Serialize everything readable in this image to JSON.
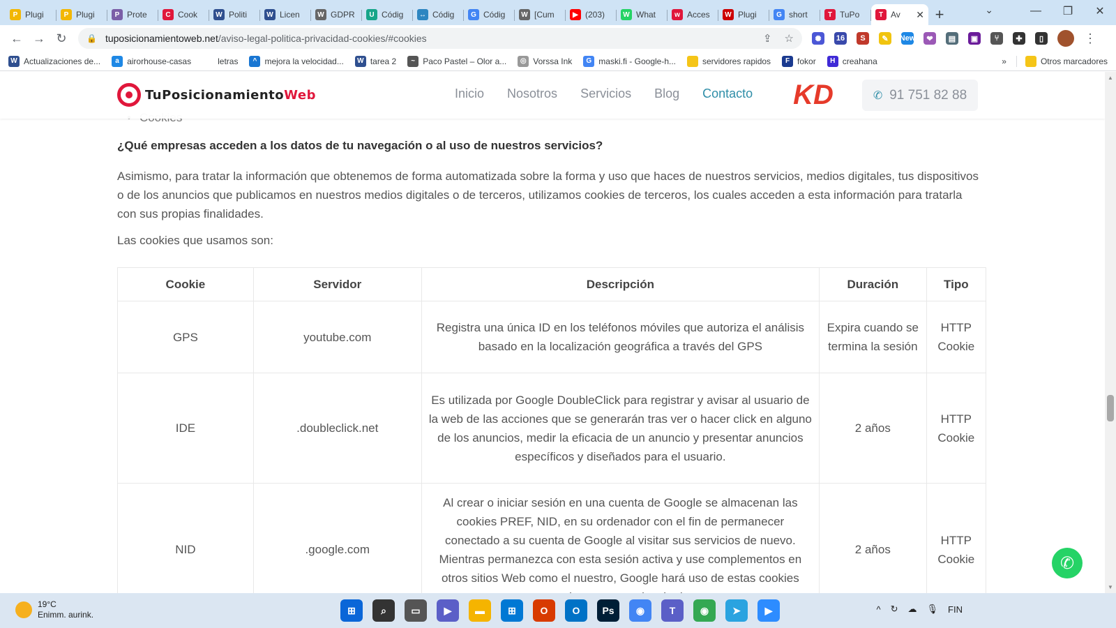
{
  "browser": {
    "tabs": [
      {
        "title": "Plugi",
        "icon_color": "#f2b705",
        "icon_glyph": "P"
      },
      {
        "title": "Plugi",
        "icon_color": "#f2b705",
        "icon_glyph": "P"
      },
      {
        "title": "Prote",
        "icon_color": "#7b5ea7",
        "icon_glyph": "P"
      },
      {
        "title": "Cook",
        "icon_color": "#e0173b",
        "icon_glyph": "C"
      },
      {
        "title": "Politi",
        "icon_color": "#2f4f8f",
        "icon_glyph": "W"
      },
      {
        "title": "Licen",
        "icon_color": "#2f4f8f",
        "icon_glyph": "W"
      },
      {
        "title": "GDPR",
        "icon_color": "#666666",
        "icon_glyph": "W"
      },
      {
        "title": "Códig",
        "icon_color": "#17a589",
        "icon_glyph": "U"
      },
      {
        "title": "Códig",
        "icon_color": "#2e86c1",
        "icon_glyph": "↔"
      },
      {
        "title": "Códig",
        "icon_color": "#4285f4",
        "icon_glyph": "G"
      },
      {
        "title": "[Cum",
        "icon_color": "#666666",
        "icon_glyph": "W"
      },
      {
        "title": "(203)",
        "icon_color": "#ff0000",
        "icon_glyph": "▶"
      },
      {
        "title": "What",
        "icon_color": "#25d366",
        "icon_glyph": "W"
      },
      {
        "title": "Acces",
        "icon_color": "#e0173b",
        "icon_glyph": "w"
      },
      {
        "title": "Plugi",
        "icon_color": "#cc0000",
        "icon_glyph": "W"
      },
      {
        "title": "short",
        "icon_color": "#4285f4",
        "icon_glyph": "G"
      },
      {
        "title": "TuPo",
        "icon_color": "#e0173b",
        "icon_glyph": "T"
      },
      {
        "title": "Av",
        "icon_color": "#e0173b",
        "icon_glyph": "T"
      }
    ],
    "close_glyph": "✕",
    "new_tab_glyph": "+",
    "tab_search_glyph": "⌄",
    "window_controls": [
      "—",
      "❐",
      "✕"
    ],
    "nav": {
      "back": "←",
      "forward": "→",
      "reload": "↻"
    },
    "url_host": "tuposicionamientoweb.net",
    "url_path": "/aviso-legal-politica-privacidad-cookies/#cookies",
    "lock_glyph": "🔒",
    "share_glyph": "⇪",
    "star_glyph": "☆",
    "extensions": [
      {
        "name": "ext-sun",
        "color": "#4b57d6",
        "glyph": "✺"
      },
      {
        "name": "ext-cap",
        "color": "#3949ab",
        "glyph": "16"
      },
      {
        "name": "ext-s",
        "color": "#c0392b",
        "glyph": "S"
      },
      {
        "name": "ext-pen",
        "color": "#f1c40f",
        "glyph": "✎"
      },
      {
        "name": "ext-new",
        "color": "#1e88e5",
        "glyph": "New"
      },
      {
        "name": "ext-heart",
        "color": "#9b59b6",
        "glyph": "❤"
      },
      {
        "name": "ext-doc",
        "color": "#546e7a",
        "glyph": "▤"
      },
      {
        "name": "ext-img",
        "color": "#6a1b9a",
        "glyph": "▣"
      },
      {
        "name": "ext-branch",
        "color": "#555555",
        "glyph": "⑂"
      },
      {
        "name": "ext-puzzle",
        "color": "#333333",
        "glyph": "✚"
      },
      {
        "name": "ext-sidepanel",
        "color": "#333333",
        "glyph": "▯"
      }
    ],
    "menu_glyph": "⋮",
    "bookmarks": [
      {
        "label": "Actualizaciones de...",
        "icon_color": "#2f4f8f",
        "icon_glyph": "W"
      },
      {
        "label": "airorhouse-casas",
        "icon_color": "#1e88e5",
        "icon_glyph": "a"
      },
      {
        "label": "letras",
        "icon_color": "#ffffff",
        "icon_glyph": ""
      },
      {
        "label": "mejora la velocidad...",
        "icon_color": "#1976d2",
        "icon_glyph": "^"
      },
      {
        "label": "tarea 2",
        "icon_color": "#2f4f8f",
        "icon_glyph": "W"
      },
      {
        "label": "Paco Pastel – Olor a...",
        "icon_color": "#555555",
        "icon_glyph": "~"
      },
      {
        "label": "Vorssa Ink",
        "icon_color": "#999999",
        "icon_glyph": "◎"
      },
      {
        "label": "maski.fi - Google-h...",
        "icon_color": "#4285f4",
        "icon_glyph": "G"
      },
      {
        "label": "servidores rapidos",
        "icon_color": "#f5c518",
        "icon_glyph": ""
      },
      {
        "label": "fokor",
        "icon_color": "#1a3a8f",
        "icon_glyph": "F"
      },
      {
        "label": "creahana",
        "icon_color": "#3f2ad6",
        "icon_glyph": "H"
      }
    ],
    "bookmarks_more": "»",
    "other_bookmarks": "Otros marcadores"
  },
  "site": {
    "logo_text_a": "Tu",
    "logo_text_b": "Posicionamiento",
    "logo_text_c": "Web",
    "nav": [
      "Inicio",
      "Nosotros",
      "Servicios",
      "Blog",
      "Contacto"
    ],
    "nav_active": "Contacto",
    "kd_logo": "KD",
    "phone_icon": "✆",
    "phone": "91 751 82 88",
    "bullet": "Cookies",
    "question": "¿Qué empresas acceden a los datos de tu navegación o al uso de nuestros servicios?",
    "paragraph": "Asimismo, para tratar la información que obtenemos de forma automatizada sobre la forma y uso que haces de nuestros servicios, medios digitales, tus dispositivos o de los anuncios que publicamos en nuestros medios digitales o de terceros, utilizamos cookies de terceros, los cuales acceden a esta información para tratarla con sus propias finalidades.",
    "cookies_intro": "Las cookies que usamos son:",
    "table": {
      "headers": [
        "Cookie",
        "Servidor",
        "Descripción",
        "Duración",
        "Tipo"
      ],
      "rows": [
        [
          "GPS",
          "youtube.com",
          "Registra una única ID en los teléfonos móviles que autoriza el análisis basado en la localización geográfica a través del GPS",
          "Expira cuando se termina la sesión",
          "HTTP Cookie"
        ],
        [
          "IDE",
          ".doubleclick.net",
          "Es utilizada por Google DoubleClick para registrar y avisar al usuario de la web de las acciones que se generarán tras ver o hacer click en alguno de los anuncios, medir la eficacia de un anuncio y presentar anuncios específicos y diseñados para el usuario.",
          "2 años",
          "HTTP Cookie"
        ],
        [
          "NID",
          ".google.com",
          "Al crear o iniciar sesión en una cuenta de Google se almacenan las cookies PREF, NID, en su ordenador con el fin de permanecer conectado a su cuenta de Google al visitar sus servicios de nuevo. Mientras permanezca con esta sesión activa y use complementos en otros sitios Web como el nuestro, Google hará uso de estas cookies para mejorar su experiencia de uso.",
          "2 años",
          "HTTP Cookie"
        ]
      ]
    },
    "whatsapp_glyph": "✆"
  },
  "scrollbar": {
    "position_fraction": 0.66
  },
  "taskbar": {
    "temperature": "19°C",
    "weather_desc": "Enimm. aurink.",
    "apps": [
      {
        "name": "start-icon",
        "color": "#0a66d8",
        "glyph": "⊞"
      },
      {
        "name": "search-icon",
        "color": "#333333",
        "glyph": "⌕"
      },
      {
        "name": "task-view-icon",
        "color": "#555555",
        "glyph": "▭"
      },
      {
        "name": "chat-icon",
        "color": "#5b5fc7",
        "glyph": "▶"
      },
      {
        "name": "file-explorer-icon",
        "color": "#f5b400",
        "glyph": "▬"
      },
      {
        "name": "store-icon",
        "color": "#0078d4",
        "glyph": "⊞"
      },
      {
        "name": "office-icon",
        "color": "#d83b01",
        "glyph": "O"
      },
      {
        "name": "outlook-icon",
        "color": "#0072c6",
        "glyph": "O"
      },
      {
        "name": "photoshop-icon",
        "color": "#001e36",
        "glyph": "Ps"
      },
      {
        "name": "chrome-icon",
        "color": "#4285f4",
        "glyph": "◉"
      },
      {
        "name": "teams-icon",
        "color": "#5b5fc7",
        "glyph": "T"
      },
      {
        "name": "chrome-profile-icon",
        "color": "#34a853",
        "glyph": "◉"
      },
      {
        "name": "telegram-icon",
        "color": "#2aa3e0",
        "glyph": "➤"
      },
      {
        "name": "zoom-icon",
        "color": "#2d8cff",
        "glyph": "▶"
      }
    ],
    "tray_chevron": "^",
    "tray_sync": "↻",
    "tray_cloud": "☁",
    "tray_mic": "🎙",
    "language": "FIN"
  }
}
